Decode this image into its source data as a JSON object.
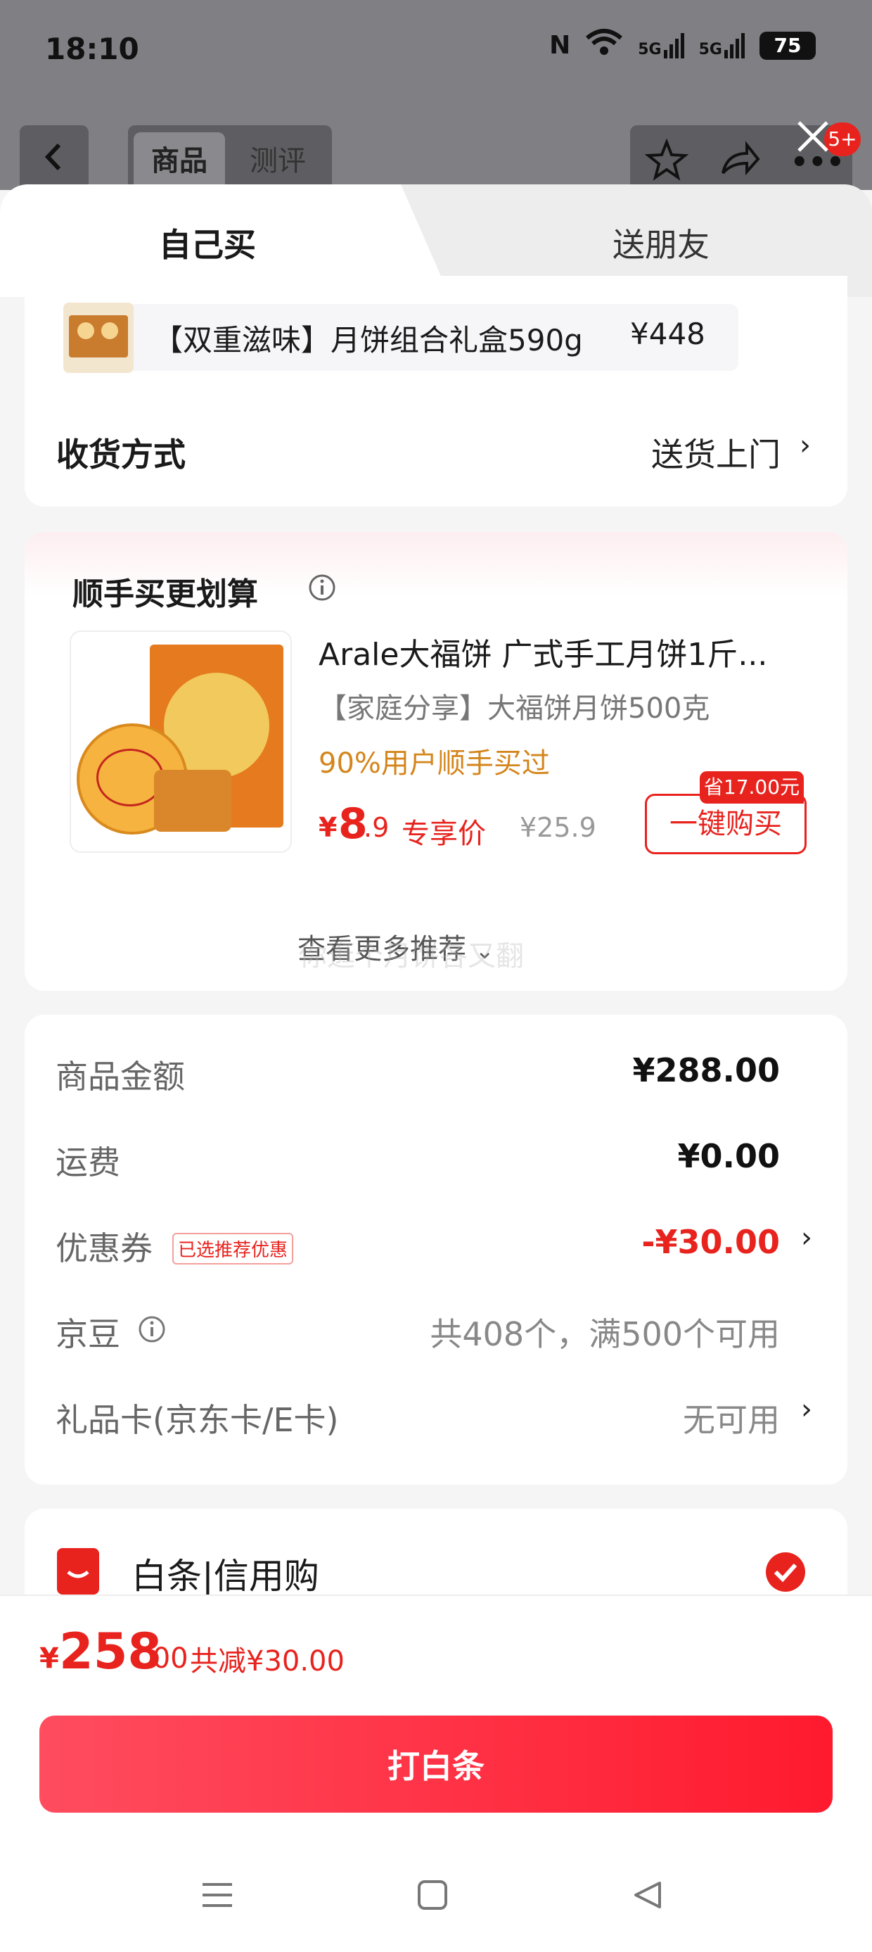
{
  "status_bar": {
    "time": "18:10",
    "nfc": "N",
    "wifi": "WiFi",
    "signal1": "5G",
    "signal2": "5G",
    "battery": "75"
  },
  "background_page": {
    "tab_product": "商品",
    "tab_review": "测评",
    "badge": "5+"
  },
  "sheet_tabs": {
    "self_buy": "自己买",
    "gift_friend": "送朋友"
  },
  "product_summary": {
    "name": "【双重滋味】月饼组合礼盒590g",
    "price": "¥448"
  },
  "delivery": {
    "label": "收货方式",
    "value": "送货上门"
  },
  "add_on": {
    "title": "顺手买更划算",
    "item_title": "Arale大福饼 广式手工月饼1斤...",
    "item_subtitle": "【家庭分享】大福饼月饼500克",
    "popularity": "90%用户顺手买过",
    "price_symbol": "¥",
    "price_int": "8",
    "price_dec": ".9",
    "price_tag": "专享价",
    "original_price": "¥25.9",
    "save_badge": "省17.00元",
    "buy_button": "一键购买",
    "more": "查看更多推荐",
    "watermark": "你逛个月饼各又翻"
  },
  "summary": {
    "items": [
      {
        "label": "商品金额",
        "value": "¥288.00"
      },
      {
        "label": "运费",
        "value": "¥0.00"
      },
      {
        "label": "优惠券",
        "tag": "已选推荐优惠",
        "value": "-¥30.00"
      },
      {
        "label": "京豆",
        "value": "共408个，满500个可用"
      },
      {
        "label": "礼品卡(京东卡/E卡)",
        "value": "无可用"
      }
    ]
  },
  "payment": {
    "label": "白条|信用购"
  },
  "footer": {
    "symbol": "¥",
    "total_int": "258",
    "total_dec": ".00",
    "discount": "共减¥30.00",
    "pay_button": "打白条"
  }
}
